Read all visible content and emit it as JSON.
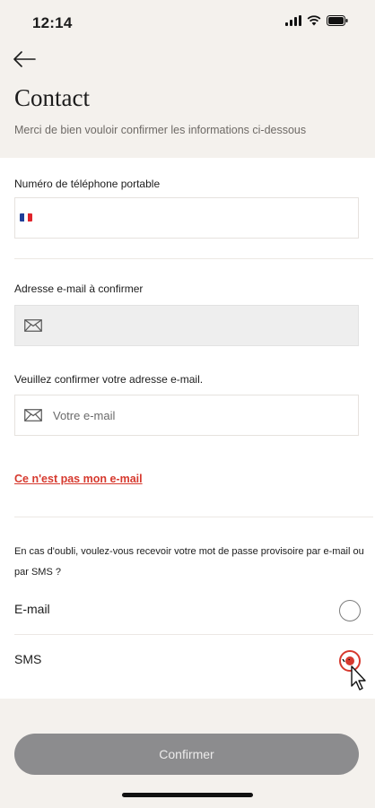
{
  "status_bar": {
    "time": "12:14"
  },
  "header": {
    "back_label": "back",
    "title": "Contact",
    "subtitle": "Merci de bien vouloir confirmer les informations ci-dessous"
  },
  "phone": {
    "label": "Numéro de téléphone portable",
    "value": "",
    "flag_colors": [
      "#1f3f99",
      "#ffffff",
      "#e0242b"
    ]
  },
  "email_confirm": {
    "label": "Adresse e-mail à confirmer",
    "value": ""
  },
  "email_verify": {
    "label": "Veuillez confirmer votre adresse e-mail.",
    "placeholder": "Votre e-mail",
    "value": ""
  },
  "not_my_email_link": "Ce n'est pas mon e-mail",
  "recovery": {
    "question": "En cas d'oubli, voulez-vous recevoir votre mot de passe provisoire par e-mail ou par SMS ?",
    "options": [
      {
        "label": "E-mail",
        "selected": false
      },
      {
        "label": "SMS",
        "selected": true
      }
    ]
  },
  "confirm_button": "Confirmer",
  "colors": {
    "accent_red": "#d6392e",
    "page_background": "#f4f1ed",
    "button_disabled": "#8c8c8e"
  }
}
